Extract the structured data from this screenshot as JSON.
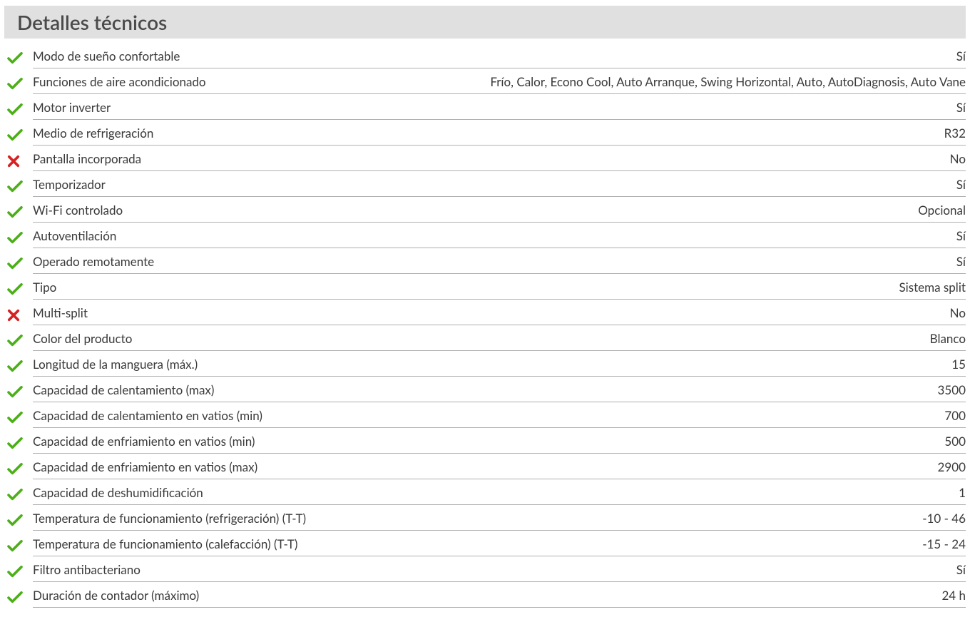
{
  "section_title": "Detalles técnicos",
  "colors": {
    "check": "#4caf18",
    "cross": "#d92020"
  },
  "specs": [
    {
      "status": "yes",
      "label": "Modo de sueño confortable",
      "value": "Sí"
    },
    {
      "status": "yes",
      "label": "Funciones de aire acondicionado",
      "value": "Frío, Calor, Econo Cool, Auto Arranque, Swing Horizontal, Auto, AutoDiagnosis, Auto Vane"
    },
    {
      "status": "yes",
      "label": "Motor inverter",
      "value": "Sí"
    },
    {
      "status": "yes",
      "label": "Medio de refrigeración",
      "value": "R32"
    },
    {
      "status": "no",
      "label": "Pantalla incorporada",
      "value": "No"
    },
    {
      "status": "yes",
      "label": "Temporizador",
      "value": "Sí"
    },
    {
      "status": "yes",
      "label": "Wi-Fi controlado",
      "value": "Opcional"
    },
    {
      "status": "yes",
      "label": "Autoventilación",
      "value": "Sí"
    },
    {
      "status": "yes",
      "label": "Operado remotamente",
      "value": "Sí"
    },
    {
      "status": "yes",
      "label": "Tipo",
      "value": "Sistema split"
    },
    {
      "status": "no",
      "label": "Multi-split",
      "value": "No"
    },
    {
      "status": "yes",
      "label": "Color del producto",
      "value": "Blanco"
    },
    {
      "status": "yes",
      "label": "Longitud de la manguera (máx.)",
      "value": "15"
    },
    {
      "status": "yes",
      "label": "Capacidad de calentamiento (max)",
      "value": "3500"
    },
    {
      "status": "yes",
      "label": "Capacidad de calentamiento en vatios (min)",
      "value": "700"
    },
    {
      "status": "yes",
      "label": "Capacidad de enfriamiento en vatios (min)",
      "value": "500"
    },
    {
      "status": "yes",
      "label": "Capacidad de enfriamiento en vatios (max)",
      "value": "2900"
    },
    {
      "status": "yes",
      "label": "Capacidad de deshumidificación",
      "value": "1"
    },
    {
      "status": "yes",
      "label": "Temperatura de funcionamiento (refrigeración) (T-T)",
      "value": "-10 - 46"
    },
    {
      "status": "yes",
      "label": "Temperatura de funcionamiento (calefacción) (T-T)",
      "value": "-15 - 24"
    },
    {
      "status": "yes",
      "label": "Filtro antibacteriano",
      "value": "Sí"
    },
    {
      "status": "yes",
      "label": "Duración de contador (máximo)",
      "value": "24 h"
    }
  ]
}
